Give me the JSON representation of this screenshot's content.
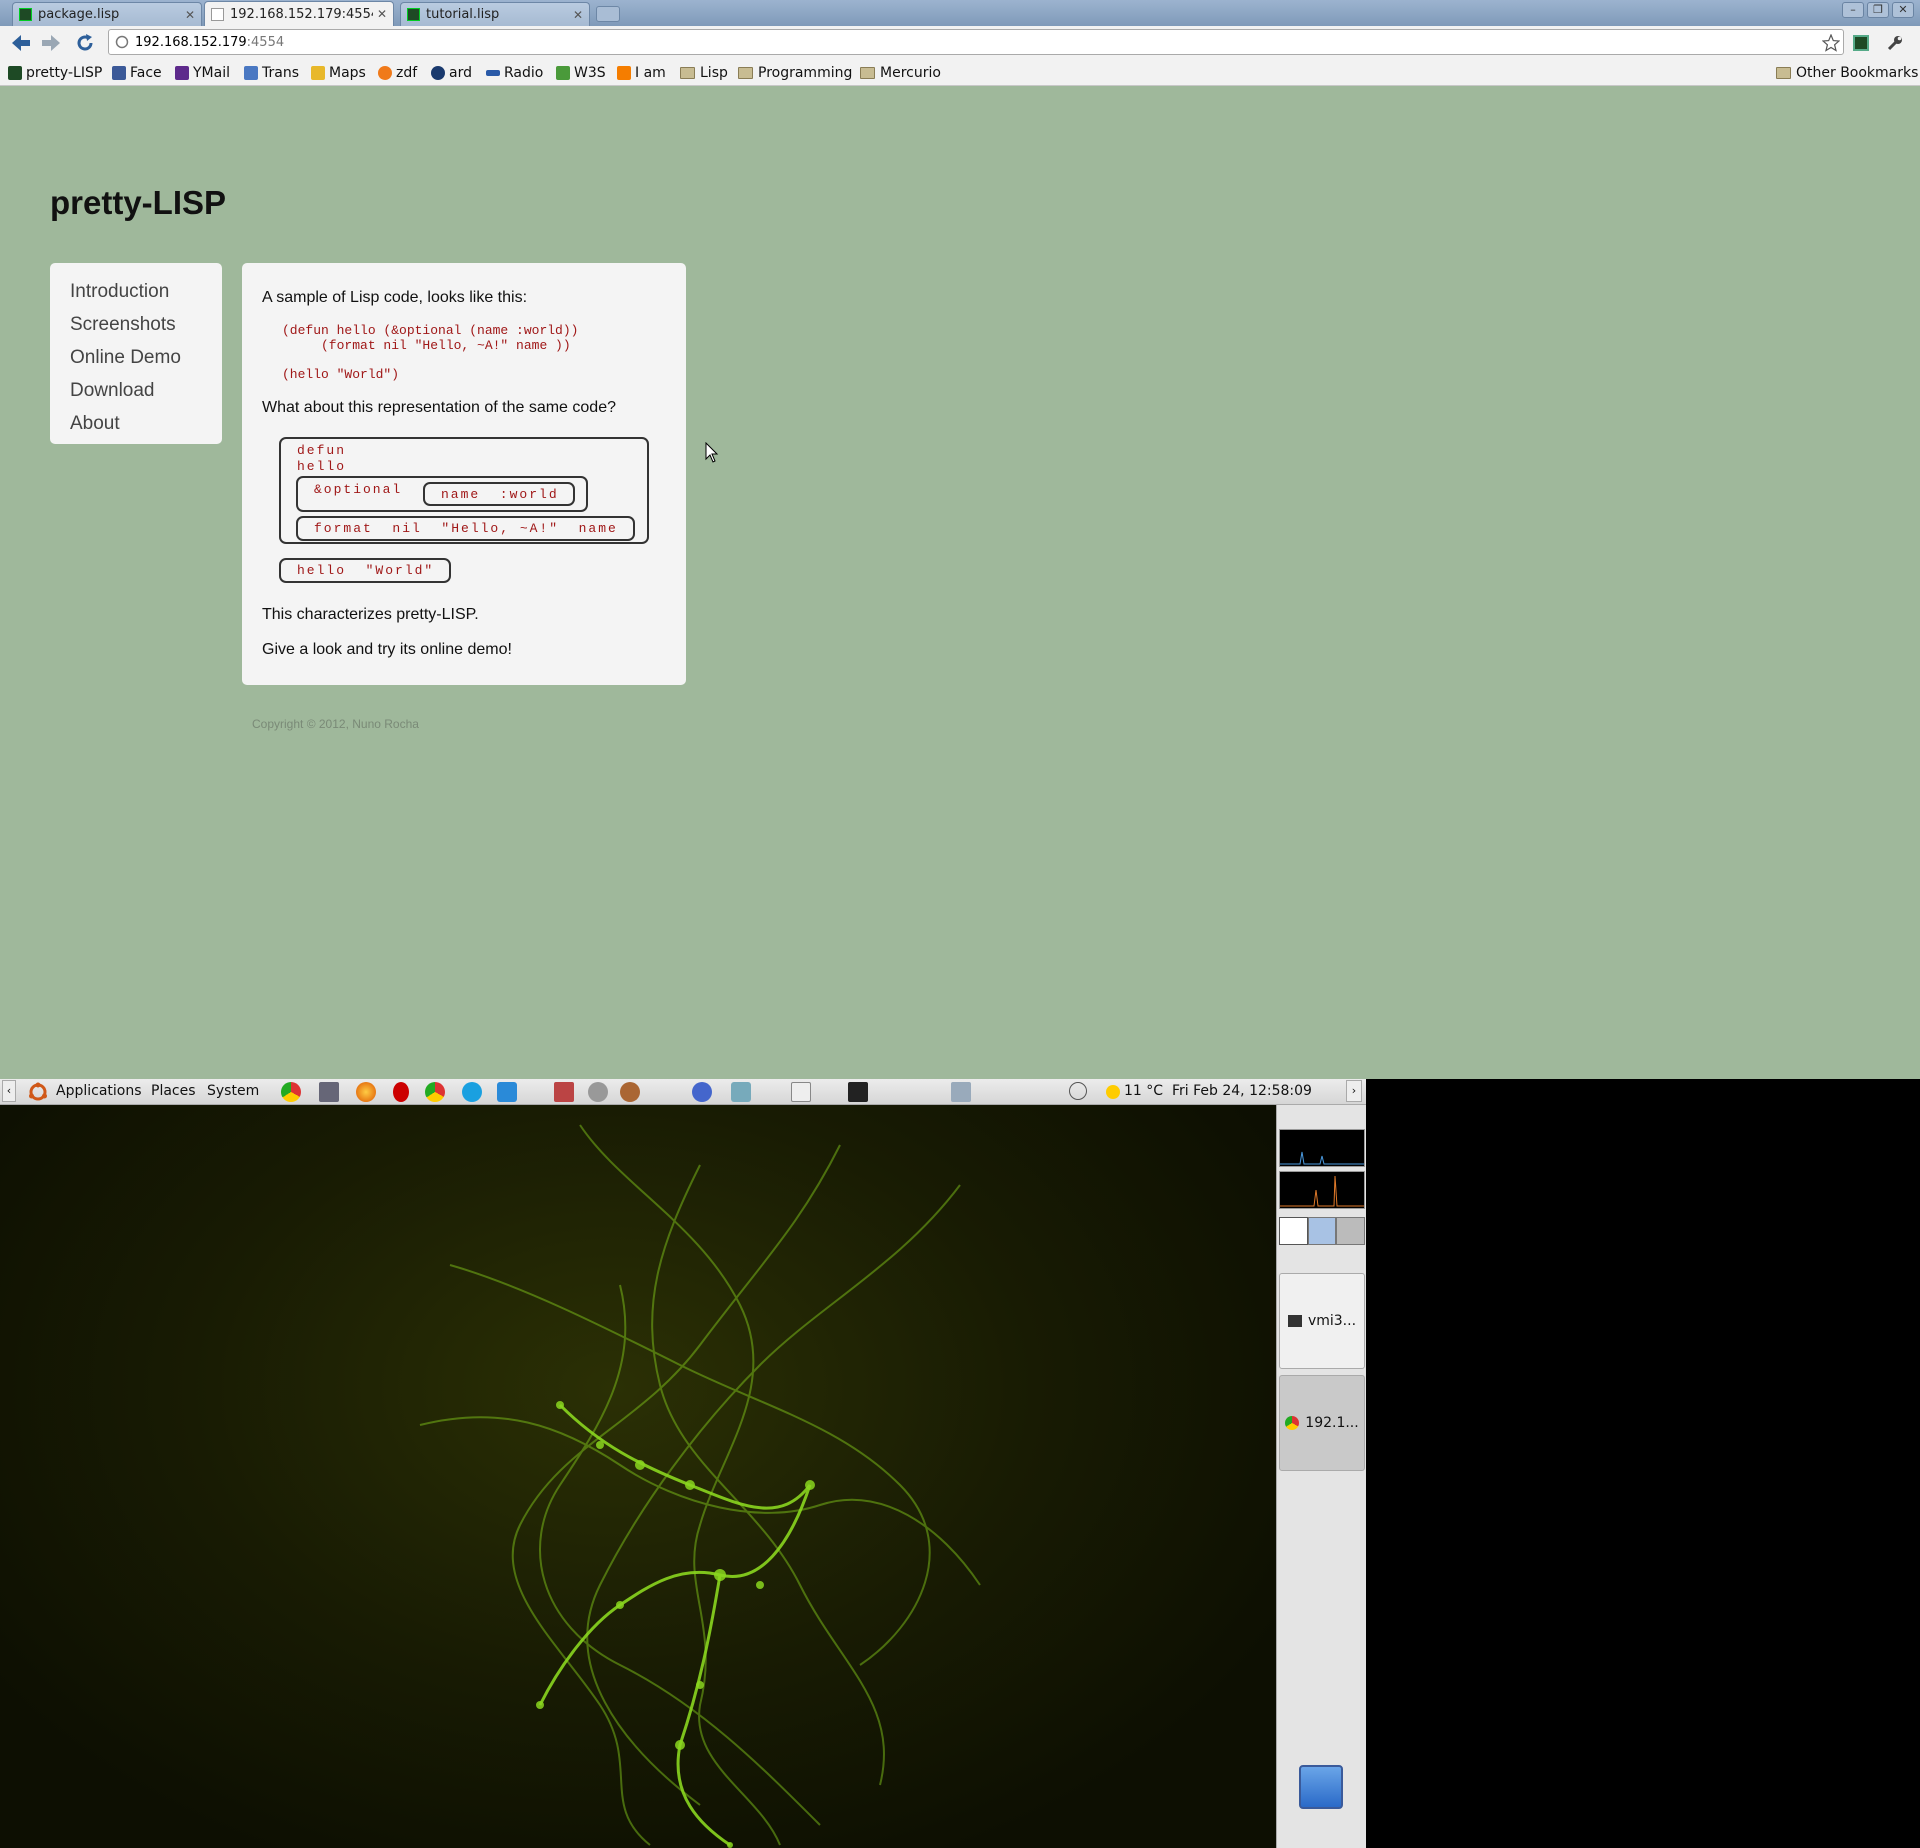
{
  "browser": {
    "tabs": [
      {
        "label": "package.lisp"
      },
      {
        "label": "192.168.152.179:4554"
      },
      {
        "label": "tutorial.lisp"
      }
    ],
    "url_host": "192.168.152.179",
    "url_port": ":4554",
    "bookmarks": [
      "pretty-LISP",
      "Face",
      "YMail",
      "Trans",
      "Maps",
      "zdf",
      "ard",
      "Radio",
      "W3S",
      "I am",
      "Lisp",
      "Programming",
      "Mercurio"
    ],
    "other_bookmarks": "Other Bookmarks"
  },
  "page": {
    "title": "pretty-LISP",
    "nav": [
      "Introduction",
      "Screenshots",
      "Online Demo",
      "Download",
      "About"
    ],
    "intro": "A sample of Lisp code, looks like this:",
    "code_line1": "(defun hello (&optional (name :world))",
    "code_line2": "     (format nil \"Hello, ~A!\" name ))",
    "code_line3": "(hello \"World\")",
    "question": "What about this representation of the same code?",
    "diagram": {
      "defun": "defun",
      "hello": "hello",
      "optional": "&optional",
      "name_world": "name  :world",
      "format": "format  nil  \"Hello, ~A!\"  name",
      "call": "hello  \"World\""
    },
    "characterizes": "This characterizes pretty-LISP.",
    "give_look": "Give a look and try its online demo!",
    "copyright": "Copyright © 2012, Nuno Rocha"
  },
  "panel": {
    "applications": "Applications",
    "places": "Places",
    "system": "System",
    "weather": "11 °C",
    "clock": "Fri Feb 24, 12:58:09"
  },
  "sidepanel": {
    "task1": "vmi3...",
    "task2": "192.1..."
  },
  "colors": {
    "page_bg": "#9fb89b",
    "code_red": "#a01818",
    "desktop_green": "#7fc21a"
  }
}
